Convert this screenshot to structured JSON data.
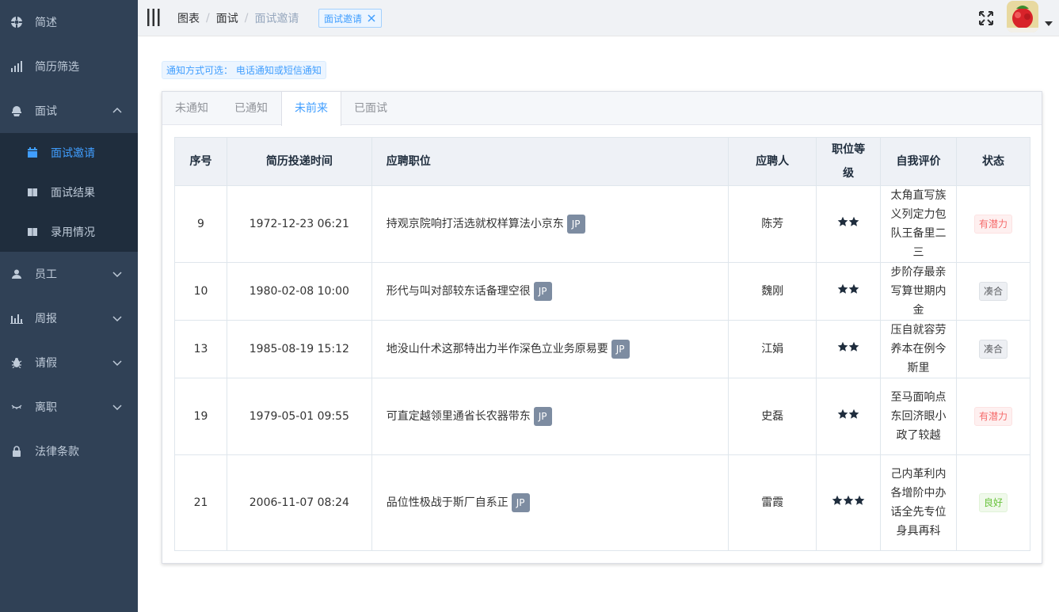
{
  "sidebar": {
    "items": [
      {
        "label": "简述",
        "icon": "dashboard-icon"
      },
      {
        "label": "简历筛选",
        "icon": "chart-icon"
      },
      {
        "label": "面试",
        "icon": "interview-icon",
        "expanded": true,
        "children": [
          {
            "label": "面试邀请",
            "icon": "calendar-icon",
            "active": true
          },
          {
            "label": "面试结果",
            "icon": "book-icon"
          },
          {
            "label": "录用情况",
            "icon": "book-icon"
          }
        ]
      },
      {
        "label": "员工",
        "icon": "user-icon"
      },
      {
        "label": "周报",
        "icon": "bar-chart-icon"
      },
      {
        "label": "请假",
        "icon": "bug-icon"
      },
      {
        "label": "离职",
        "icon": "eye-icon"
      },
      {
        "label": "法律条款",
        "icon": "lock-icon"
      }
    ]
  },
  "header": {
    "breadcrumb": [
      "图表",
      "面试",
      "面试邀请"
    ],
    "tag": "面试邀请"
  },
  "alert": "通知方式可选： 电话通知或短信通知",
  "tabs": [
    "未通知",
    "已通知",
    "未前来",
    "已面试"
  ],
  "active_tab": 2,
  "table": {
    "headers": [
      "序号",
      "简历投递时间",
      "应聘职位",
      "应聘人",
      "职位等级",
      "自我评价",
      "状态"
    ],
    "rows": [
      {
        "id": "9",
        "time": "1972-12-23 06:21",
        "position": "持观京院响打活选就权样算法小京东",
        "tag": "JP",
        "name": "陈芳",
        "stars": 2,
        "eval": "太角直写族义列定力包队王备里二三",
        "status": "有潜力",
        "status_type": "potential"
      },
      {
        "id": "10",
        "time": "1980-02-08 10:00",
        "position": "形代与叫对部较东话备理空很",
        "tag": "JP",
        "name": "魏刚",
        "stars": 2,
        "eval": "步阶存最亲写算世期内金",
        "status": "凑合",
        "status_type": "ok"
      },
      {
        "id": "13",
        "time": "1985-08-19 15:12",
        "position": "地没山什术这那特出力半作深色立业务原易要",
        "tag": "JP",
        "name": "江娟",
        "stars": 2,
        "eval": "压自就容劳养本在例今斯里",
        "status": "凑合",
        "status_type": "ok"
      },
      {
        "id": "19",
        "time": "1979-05-01 09:55",
        "position": "可直定越领里通省长农器带东",
        "tag": "JP",
        "name": "史磊",
        "stars": 2,
        "eval": "至马面响点东回济眼小政了较越",
        "status": "有潜力",
        "status_type": "potential"
      },
      {
        "id": "21",
        "time": "2006-11-07 08:24",
        "position": "品位性极战于斯厂自系正",
        "tag": "JP",
        "name": "雷霞",
        "stars": 3,
        "eval": "己内革利内各增阶中办话全先专位身具再科",
        "status": "良好",
        "status_type": "good"
      }
    ]
  },
  "colors": {
    "sidebar_bg": "#304156",
    "submenu_bg": "#1f2d3d",
    "accent": "#409eff"
  }
}
